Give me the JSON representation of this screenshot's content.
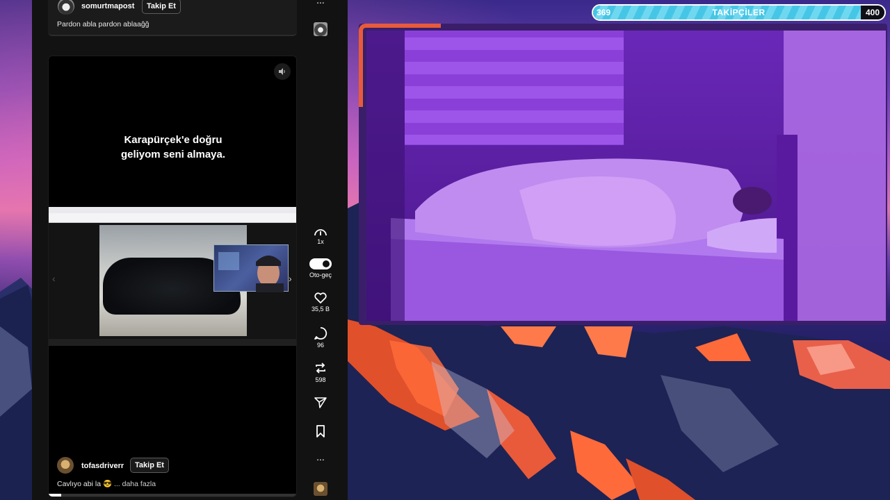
{
  "feed": {
    "top_post": {
      "username": "somurtmapost",
      "follow_label": "Takip Et",
      "caption": "Pardon abla pardon ablaaĝğ"
    },
    "video_post": {
      "overlay_text_line1": "Karapürçek'e doğru",
      "overlay_text_line2": "geliyom seni almaya.",
      "username": "tofasdriverr",
      "follow_label": "Takip Et",
      "caption": "Cavlıyo abi la 😎",
      "more_label": "... daha fazla",
      "progress_fraction": 0.05
    }
  },
  "rail": {
    "top_more": "...",
    "speed_label": "1x",
    "autoplay_label": "Oto-geç",
    "likes": "35,5 B",
    "comments": "96",
    "reposts": "598",
    "bottom_more": "..."
  },
  "goal_bar": {
    "start_value": "369",
    "title": "TAKİPÇİLER",
    "end_value": "400",
    "fill_fraction": 0.92,
    "color": "#46c6e6"
  },
  "colors": {
    "accent": "#e85a3a",
    "cam_tint": "#7a2ad6"
  }
}
